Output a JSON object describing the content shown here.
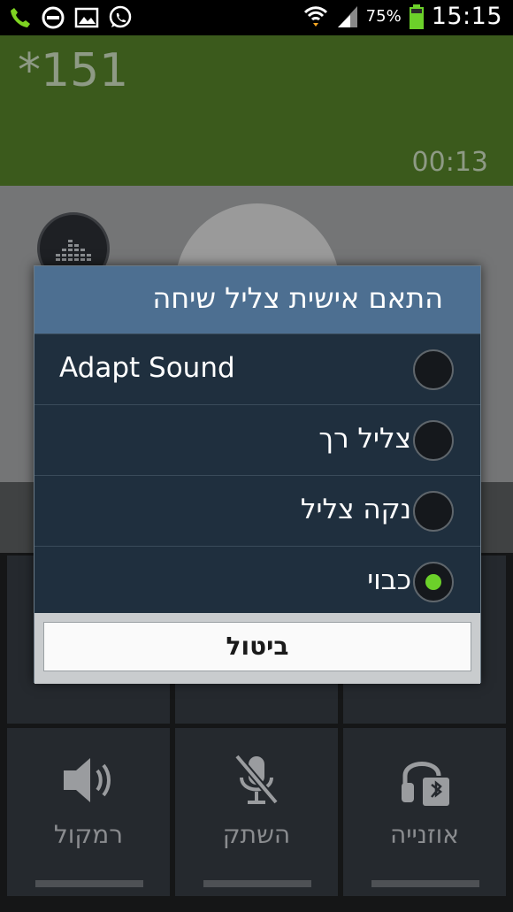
{
  "status_bar": {
    "icons": [
      "phone-call-icon",
      "do-not-disturb-icon",
      "gallery-icon",
      "whatsapp-icon",
      "wifi-icon",
      "signal-icon"
    ],
    "battery_percent": "75%",
    "time": "15:15"
  },
  "call": {
    "number": "*151",
    "timer": "00:13"
  },
  "dialog": {
    "title": "התאם אישית צליל שיחה",
    "options": [
      {
        "label": "Adapt Sound",
        "selected": false
      },
      {
        "label": "צליל רך",
        "selected": false
      },
      {
        "label": "נקה צליל",
        "selected": false
      },
      {
        "label": "כבוי",
        "selected": true
      }
    ],
    "cancel_label": "ביטול"
  },
  "controls": {
    "speaker_label": "רמקול",
    "mute_label": "השתק",
    "headset_label": "אוזנייה"
  },
  "colors": {
    "call_header": "#3b5a1c",
    "dialog_title": "#4d6f91",
    "radio_selected": "#6cd12a"
  }
}
